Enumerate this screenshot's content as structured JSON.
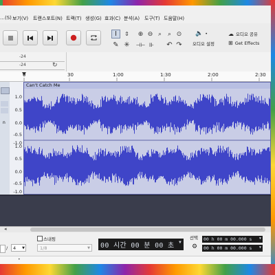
{
  "menu": [
    "…(S)",
    "보기(V)",
    "트랜스포트(N)",
    "트랙(T)",
    "생성(G)",
    "효과(C)",
    "분석(A)",
    "도구(T)",
    "도움말(H)"
  ],
  "toolbar": {
    "audio_setup_label": "오디오 설정",
    "audio_share_label": "오디오 공유",
    "get_effects_label": "Get Effects"
  },
  "meter": {
    "left_db": "-24",
    "right_db": "-24"
  },
  "ruler": {
    "ticks": [
      "0",
      "30",
      "1:00",
      "1:30",
      "2:00",
      "2:30"
    ]
  },
  "track": {
    "clip_name": "Can't Catch Me",
    "scale_labels": [
      "1.0",
      "0.5",
      "0.0",
      "-0.5",
      "-1.0"
    ]
  },
  "status": {
    "snap_label": "스내핑",
    "snap_value": "1/8",
    "time_sig_slash": "/",
    "time_sig_denominator": "4",
    "time_display": "00 시간 00 분 00 초",
    "selection_label": "선택",
    "selection_start": "00 h 00 m 00.000 s",
    "selection_end": "00 h 00 m 00.000 s"
  },
  "colors": {
    "waveform": "#3f45c8",
    "track_bg": "#c9cde6",
    "time_bg": "#1b1b1b",
    "record": "#cc1f1f"
  }
}
